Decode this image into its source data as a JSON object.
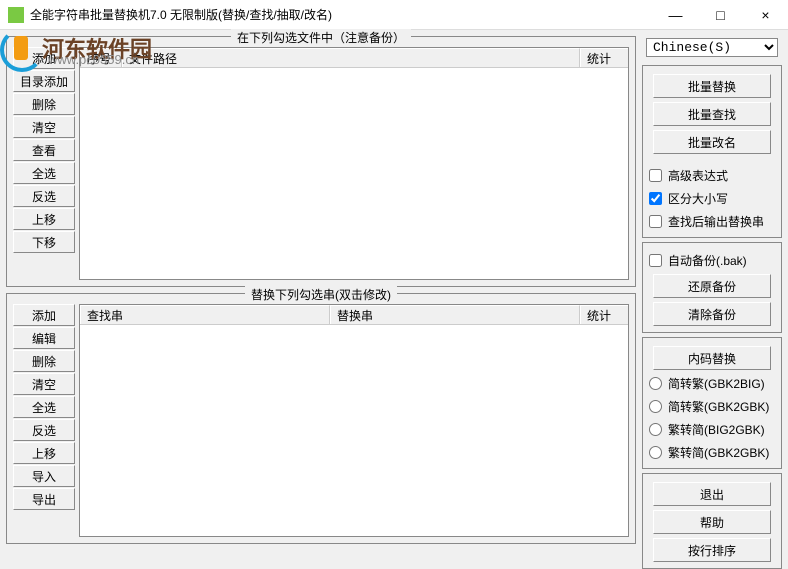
{
  "titlebar": {
    "title": "全能字符串批量替换机7.0 无限制版(替换/查找/抽取/改名)",
    "minimize": "—",
    "maximize": "□",
    "close": "×"
  },
  "watermark": {
    "text": "河东软件园",
    "url": "www.pc0359.cn"
  },
  "top_panel": {
    "title": "在下列勾选文件中（注意备份）",
    "buttons": [
      "添加",
      "目录添加",
      "删除",
      "清空",
      "查看",
      "全选",
      "反选",
      "上移",
      "下移"
    ],
    "columns": [
      {
        "label": "序号",
        "width": 42
      },
      {
        "label": "文件路径",
        "width": 0
      },
      {
        "label": "统计",
        "width": 48
      }
    ]
  },
  "bottom_panel": {
    "title": "替换下列勾选串(双击修改)",
    "buttons": [
      "添加",
      "编辑",
      "删除",
      "清空",
      "全选",
      "反选",
      "上移",
      "导入",
      "导出"
    ],
    "columns": [
      {
        "label": "查找串",
        "width": 0
      },
      {
        "label": "替换串",
        "width": 0
      },
      {
        "label": "统计",
        "width": 48
      }
    ]
  },
  "right": {
    "lang_options": [
      "Chinese(S)"
    ],
    "lang_selected": "Chinese(S)",
    "batch_buttons": [
      "批量替换",
      "批量查找",
      "批量改名"
    ],
    "options": {
      "advanced": {
        "label": "高级表达式",
        "checked": false
      },
      "case": {
        "label": "区分大小写",
        "checked": true
      },
      "output": {
        "label": "查找后输出替换串",
        "checked": false
      }
    },
    "backup": {
      "auto": {
        "label": "自动备份(.bak)",
        "checked": false
      },
      "restore": "还原备份",
      "clear": "清除备份"
    },
    "encoding": {
      "title": "内码替换",
      "opts": [
        {
          "label": "简转繁(GBK2BIG)",
          "value": "gbk2big"
        },
        {
          "label": "简转繁(GBK2GBK)",
          "value": "gbk2gbk"
        },
        {
          "label": "繁转简(BIG2GBK)",
          "value": "big2gbk"
        },
        {
          "label": "繁转简(GBK2GBK)",
          "value": "gbk2gbk2"
        }
      ]
    },
    "footer": [
      "退出",
      "帮助",
      "按行排序"
    ]
  }
}
